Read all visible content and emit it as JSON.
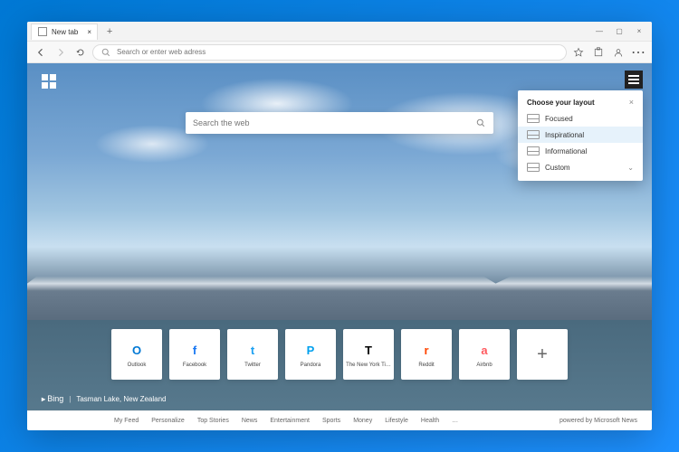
{
  "tab": {
    "title": "New tab"
  },
  "toolbar": {
    "address_placeholder": "Search or enter web adress"
  },
  "search": {
    "placeholder": "Search the web"
  },
  "layout_popup": {
    "title": "Choose your layout",
    "options": [
      {
        "label": "Focused",
        "selected": false
      },
      {
        "label": "Inspirational",
        "selected": true
      },
      {
        "label": "Informational",
        "selected": false
      },
      {
        "label": "Custom",
        "selected": false,
        "expandable": true
      }
    ]
  },
  "quicklinks": [
    {
      "label": "Outlook",
      "color": "#0078d4",
      "glyph": "O"
    },
    {
      "label": "Facebook",
      "color": "#1877f2",
      "glyph": "f"
    },
    {
      "label": "Twitter",
      "color": "#1da1f2",
      "glyph": "t"
    },
    {
      "label": "Pandora",
      "color": "#00a0ee",
      "glyph": "P"
    },
    {
      "label": "The New York Ti…",
      "color": "#000000",
      "glyph": "T"
    },
    {
      "label": "Reddit",
      "color": "#ff4500",
      "glyph": "r"
    },
    {
      "label": "Airbnb",
      "color": "#ff5a5f",
      "glyph": "a"
    }
  ],
  "credit": {
    "brand": "Bing",
    "location": "Tasman Lake, New Zealand"
  },
  "bottombar": {
    "links": [
      "My Feed",
      "Personalize",
      "Top Stories",
      "News",
      "Entertainment",
      "Sports",
      "Money",
      "Lifestyle",
      "Health",
      "…"
    ],
    "powered": "powered by Microsoft News"
  }
}
